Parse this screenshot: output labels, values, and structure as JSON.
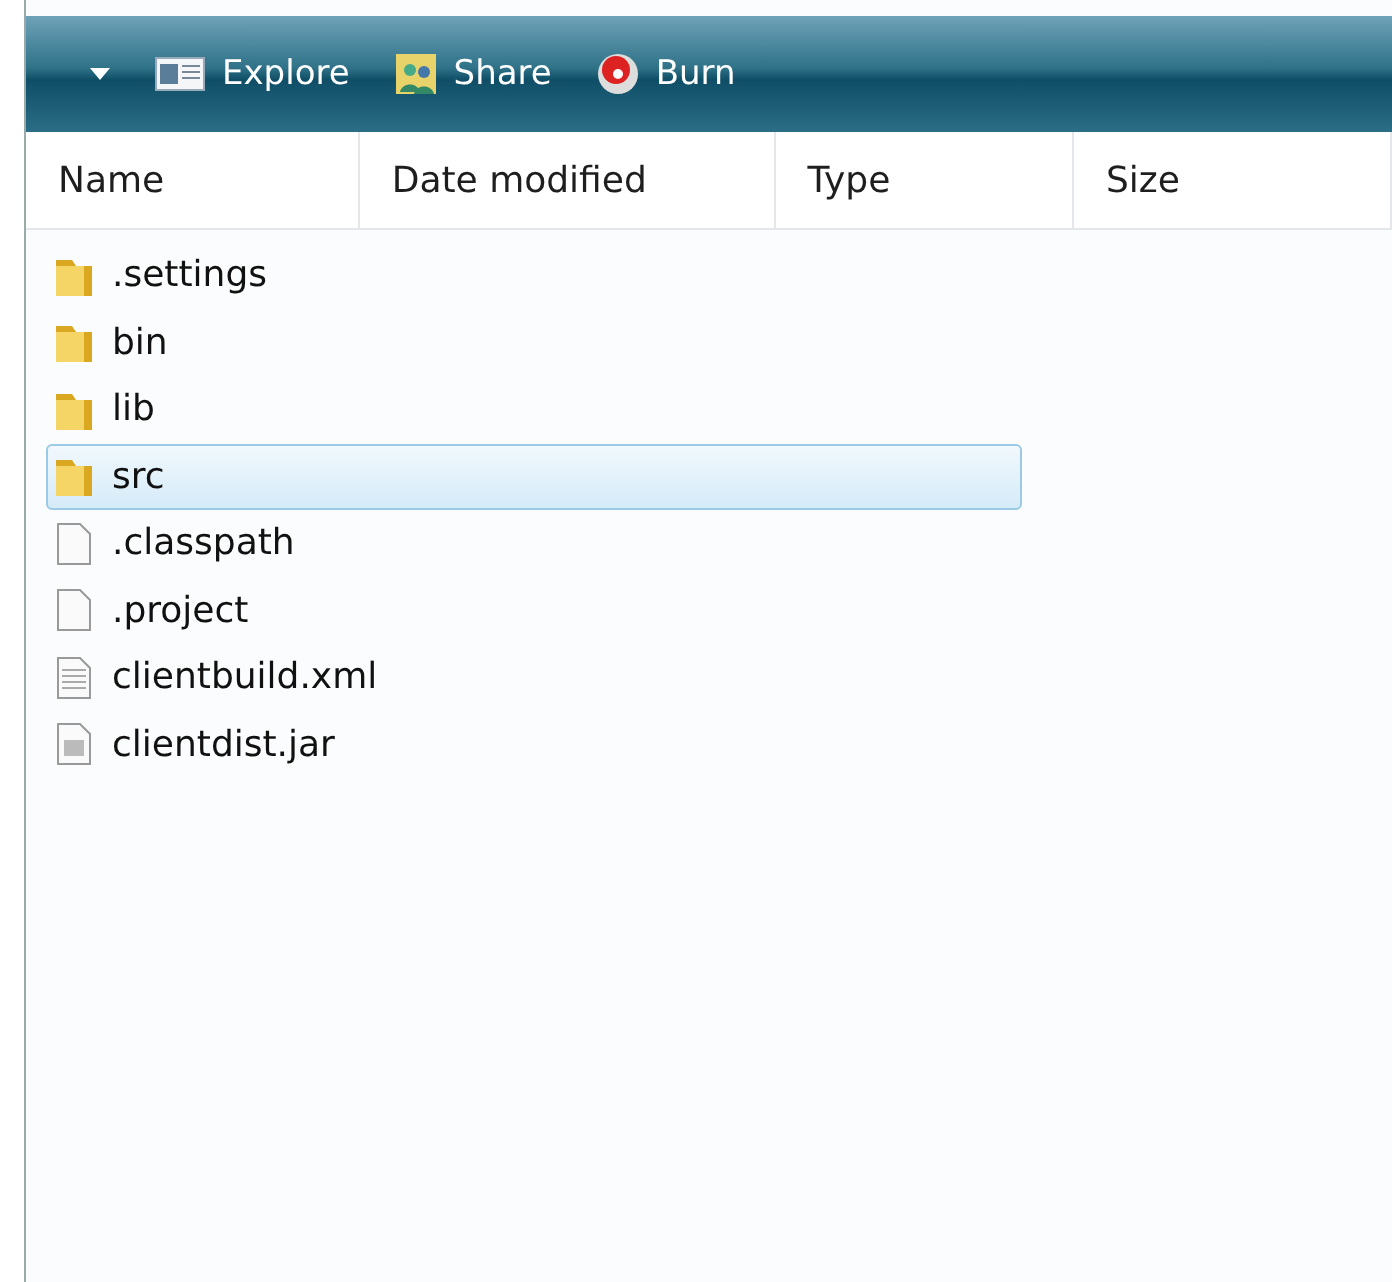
{
  "toolbar": {
    "buttons": [
      {
        "kind": "explore",
        "label": "Explore"
      },
      {
        "kind": "share",
        "label": "Share"
      },
      {
        "kind": "burn",
        "label": "Burn"
      }
    ]
  },
  "table": {
    "columns": [
      "Name",
      "Date modified",
      "Type",
      "Size"
    ],
    "rows": [
      {
        "name": ".settings",
        "kind": "folder",
        "selected": false
      },
      {
        "name": "bin",
        "kind": "folder",
        "selected": false
      },
      {
        "name": "lib",
        "kind": "folder",
        "selected": false
      },
      {
        "name": "src",
        "kind": "folder",
        "selected": true
      },
      {
        "name": ".classpath",
        "kind": "file",
        "selected": false
      },
      {
        "name": ".project",
        "kind": "file",
        "selected": false
      },
      {
        "name": "clientbuild.xml",
        "kind": "text",
        "selected": false
      },
      {
        "name": "clientdist.jar",
        "kind": "jar",
        "selected": false
      }
    ]
  }
}
